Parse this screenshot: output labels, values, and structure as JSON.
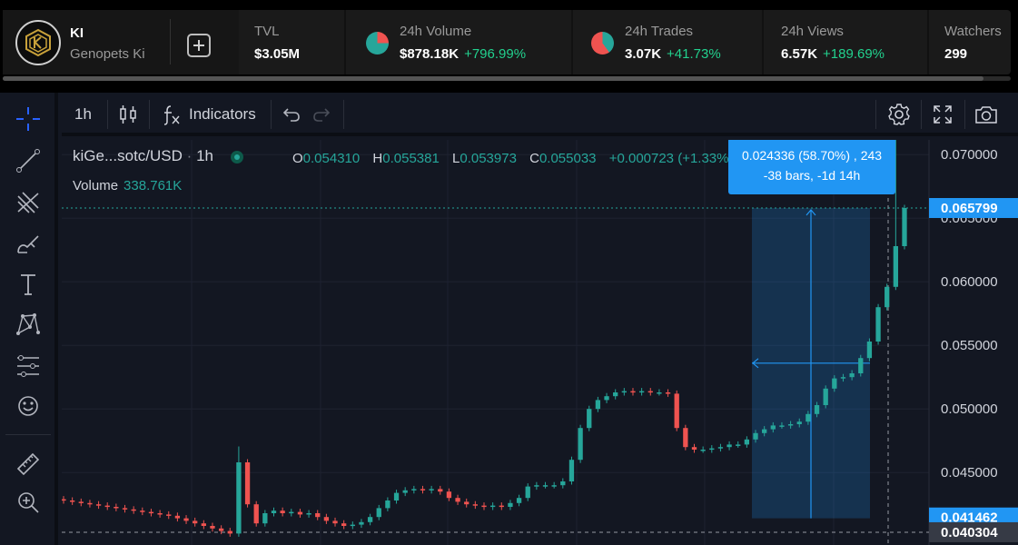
{
  "header": {
    "ticker": "KI",
    "token_name": "Genopets Ki",
    "stats": [
      {
        "label": "TVL",
        "value": "$3.05M",
        "change": ""
      },
      {
        "label": "24h Volume",
        "value": "$878.18K",
        "change": "+796.99%"
      },
      {
        "label": "24h Trades",
        "value": "3.07K",
        "change": "+41.73%"
      },
      {
        "label": "24h Views",
        "value": "6.57K",
        "change": "+189.69%"
      },
      {
        "label": "Watchers",
        "value": "299",
        "change": ""
      }
    ]
  },
  "toolbar": {
    "interval": "1h",
    "indicators_label": "Indicators"
  },
  "legend": {
    "symbol": "kiGe...sotc/USD",
    "separator": "·",
    "interval": "1h",
    "o_key": "O",
    "o_val": "0.054310",
    "h_key": "H",
    "h_val": "0.055381",
    "l_key": "L",
    "l_val": "0.053973",
    "c_key": "C",
    "c_val": "0.055033",
    "change": "+0.000723 (+1.33%)",
    "volume_label": "Volume",
    "volume_value": "338.761K"
  },
  "measure": {
    "line1": "0.024336 (58.70%) , 243",
    "line2": "-38 bars, -1d 14h"
  },
  "price_axis": {
    "ticks": [
      "0.070000",
      "0.065000",
      "0.060000",
      "0.055000",
      "0.050000",
      "0.045000"
    ],
    "last_price": "0.065799",
    "measure_low": "0.041462",
    "crosshair_price": "0.040304"
  },
  "colors": {
    "up": "#26a69a",
    "down": "#ef5350",
    "background": "#131722",
    "accent": "#2196f3"
  },
  "icons": {
    "tools": [
      "crosshair-icon",
      "trend-line-icon",
      "fib-icon",
      "brush-icon",
      "text-icon",
      "pattern-icon",
      "forecast-icon",
      "emoji-icon",
      "ruler-icon",
      "zoom-in-icon"
    ],
    "toolbar": [
      "candles-icon",
      "fx-icon",
      "undo-icon",
      "redo-icon",
      "settings-icon",
      "fullscreen-icon",
      "camera-icon"
    ]
  },
  "chart_data": {
    "type": "candlestick",
    "symbol": "kiGe...sotc/USD",
    "interval": "1h",
    "ylim": [
      0.0385,
      0.0725
    ],
    "y_ticks": [
      0.045,
      0.05,
      0.055,
      0.06,
      0.065,
      0.07
    ],
    "grid": true,
    "closes": [
      0.0428,
      0.0427,
      0.0426,
      0.0425,
      0.0424,
      0.0423,
      0.0422,
      0.0421,
      0.042,
      0.0419,
      0.0418,
      0.0417,
      0.0416,
      0.0414,
      0.0412,
      0.041,
      0.0408,
      0.0406,
      0.0404,
      0.0402,
      0.0458,
      0.0425,
      0.041,
      0.0418,
      0.042,
      0.0418,
      0.0419,
      0.0417,
      0.0418,
      0.0415,
      0.0412,
      0.041,
      0.0408,
      0.0409,
      0.0411,
      0.0415,
      0.0422,
      0.0428,
      0.0434,
      0.0436,
      0.0437,
      0.0436,
      0.0437,
      0.0435,
      0.043,
      0.0427,
      0.0425,
      0.0424,
      0.0423,
      0.0424,
      0.0423,
      0.0426,
      0.043,
      0.0439,
      0.044,
      0.044,
      0.044,
      0.0443,
      0.046,
      0.0485,
      0.05,
      0.0507,
      0.051,
      0.0513,
      0.0514,
      0.0513,
      0.0514,
      0.0513,
      0.0513,
      0.0512,
      0.0485,
      0.047,
      0.0468,
      0.0468,
      0.0469,
      0.047,
      0.0472,
      0.0472,
      0.0476,
      0.0481,
      0.0484,
      0.0487,
      0.0487,
      0.0488,
      0.049,
      0.0496,
      0.0503,
      0.0516,
      0.0524,
      0.0525,
      0.0528,
      0.054,
      0.0553,
      0.058,
      0.0596,
      0.0628,
      0.0658
    ]
  }
}
